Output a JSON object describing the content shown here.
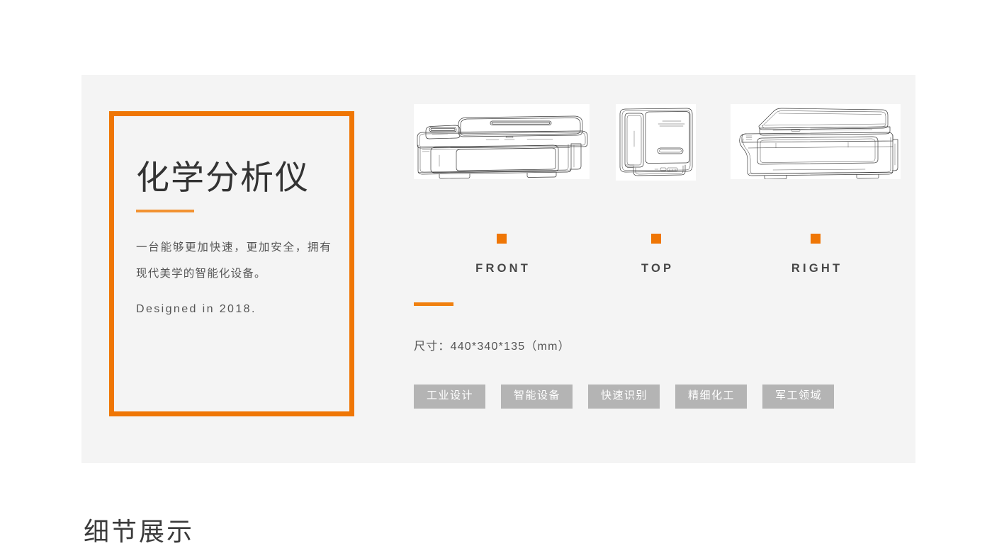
{
  "panel": {
    "background_color": "#f4f4f4",
    "accent_color": "#ef7605"
  },
  "spec_card": {
    "title": "化学分析仪",
    "description": "一台能够更加快速，更加安全，拥有现代美学的智能化设备。",
    "design_year": "Designed in 2018."
  },
  "views": [
    {
      "key": "front",
      "label": "FRONT",
      "figure_name": "chemical-analyzer-front-view-drawing"
    },
    {
      "key": "top",
      "label": "TOP",
      "figure_name": "chemical-analyzer-top-view-drawing"
    },
    {
      "key": "right",
      "label": "RIGHT",
      "figure_name": "chemical-analyzer-right-view-drawing"
    }
  ],
  "dimensions": {
    "text": "尺寸：440*340*135（mm）"
  },
  "tags": [
    {
      "label": "工业设计"
    },
    {
      "label": "智能设备"
    },
    {
      "label": "快速识别"
    },
    {
      "label": "精细化工"
    },
    {
      "label": "军工领域"
    }
  ],
  "section_heading": "细节展示"
}
